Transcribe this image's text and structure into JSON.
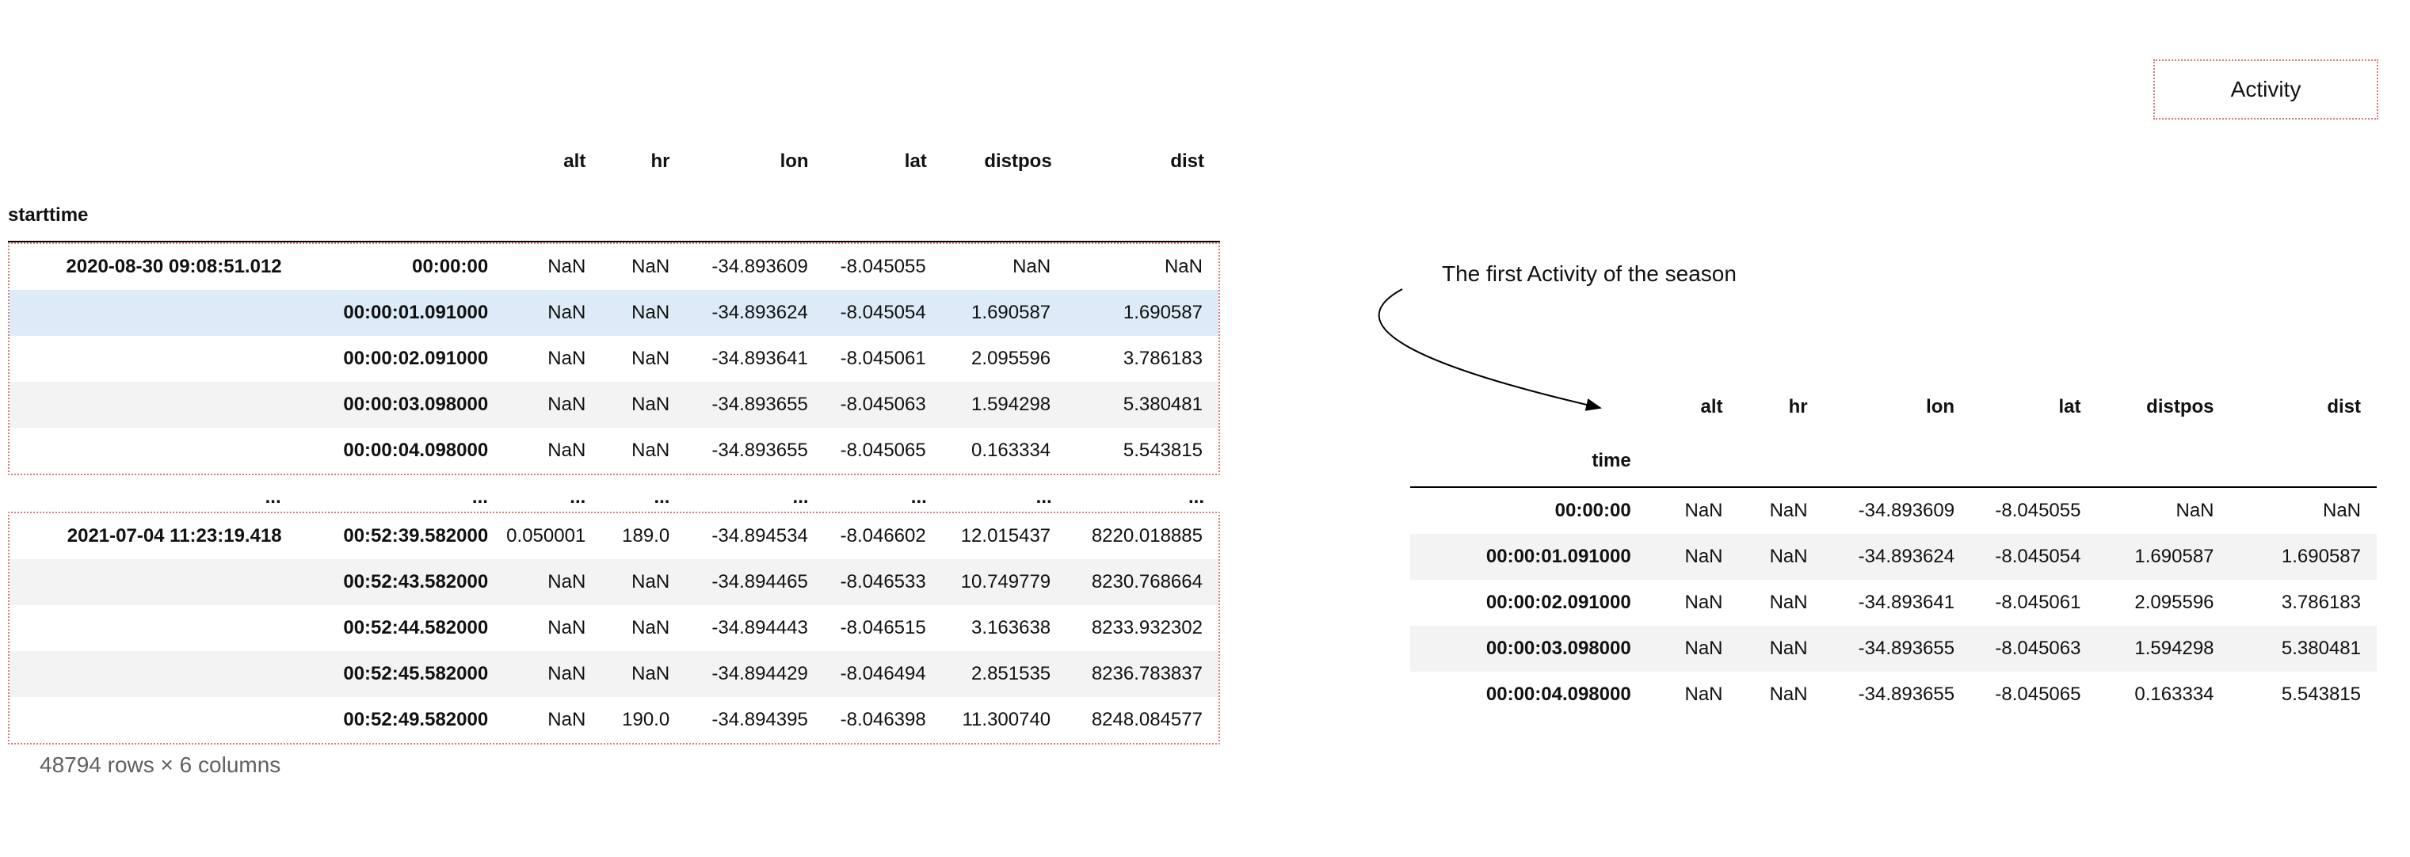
{
  "activity_label": "Activity",
  "annotation": "The first Activity of the season",
  "left_table": {
    "columns": [
      "alt",
      "hr",
      "lon",
      "lat",
      "distpos",
      "dist"
    ],
    "index_names": [
      "start",
      "time"
    ],
    "block1_start": "2020-08-30 09:08:51.012",
    "block1_rows": [
      {
        "time": "00:00:00",
        "alt": "NaN",
        "hr": "NaN",
        "lon": "-34.893609",
        "lat": "-8.045055",
        "distpos": "NaN",
        "dist": "NaN"
      },
      {
        "time": "00:00:01.091000",
        "alt": "NaN",
        "hr": "NaN",
        "lon": "-34.893624",
        "lat": "-8.045054",
        "distpos": "1.690587",
        "dist": "1.690587"
      },
      {
        "time": "00:00:02.091000",
        "alt": "NaN",
        "hr": "NaN",
        "lon": "-34.893641",
        "lat": "-8.045061",
        "distpos": "2.095596",
        "dist": "3.786183"
      },
      {
        "time": "00:00:03.098000",
        "alt": "NaN",
        "hr": "NaN",
        "lon": "-34.893655",
        "lat": "-8.045063",
        "distpos": "1.594298",
        "dist": "5.380481"
      },
      {
        "time": "00:00:04.098000",
        "alt": "NaN",
        "hr": "NaN",
        "lon": "-34.893655",
        "lat": "-8.045065",
        "distpos": "0.163334",
        "dist": "5.543815"
      }
    ],
    "ellipsis": "...",
    "block2_start": "2021-07-04 11:23:19.418",
    "block2_rows": [
      {
        "time": "00:52:39.582000",
        "alt": "0.050001",
        "hr": "189.0",
        "lon": "-34.894534",
        "lat": "-8.046602",
        "distpos": "12.015437",
        "dist": "8220.018885"
      },
      {
        "time": "00:52:43.582000",
        "alt": "NaN",
        "hr": "NaN",
        "lon": "-34.894465",
        "lat": "-8.046533",
        "distpos": "10.749779",
        "dist": "8230.768664"
      },
      {
        "time": "00:52:44.582000",
        "alt": "NaN",
        "hr": "NaN",
        "lon": "-34.894443",
        "lat": "-8.046515",
        "distpos": "3.163638",
        "dist": "8233.932302"
      },
      {
        "time": "00:52:45.582000",
        "alt": "NaN",
        "hr": "NaN",
        "lon": "-34.894429",
        "lat": "-8.046494",
        "distpos": "2.851535",
        "dist": "8236.783837"
      },
      {
        "time": "00:52:49.582000",
        "alt": "NaN",
        "hr": "190.0",
        "lon": "-34.894395",
        "lat": "-8.046398",
        "distpos": "11.300740",
        "dist": "8248.084577"
      }
    ],
    "footer": "48794 rows × 6 columns"
  },
  "right_table": {
    "columns": [
      "alt",
      "hr",
      "lon",
      "lat",
      "distpos",
      "dist"
    ],
    "index_name": "time",
    "rows": [
      {
        "time": "00:00:00",
        "alt": "NaN",
        "hr": "NaN",
        "lon": "-34.893609",
        "lat": "-8.045055",
        "distpos": "NaN",
        "dist": "NaN"
      },
      {
        "time": "00:00:01.091000",
        "alt": "NaN",
        "hr": "NaN",
        "lon": "-34.893624",
        "lat": "-8.045054",
        "distpos": "1.690587",
        "dist": "1.690587"
      },
      {
        "time": "00:00:02.091000",
        "alt": "NaN",
        "hr": "NaN",
        "lon": "-34.893641",
        "lat": "-8.045061",
        "distpos": "2.095596",
        "dist": "3.786183"
      },
      {
        "time": "00:00:03.098000",
        "alt": "NaN",
        "hr": "NaN",
        "lon": "-34.893655",
        "lat": "-8.045063",
        "distpos": "1.594298",
        "dist": "5.380481"
      },
      {
        "time": "00:00:04.098000",
        "alt": "NaN",
        "hr": "NaN",
        "lon": "-34.893655",
        "lat": "-8.045065",
        "distpos": "0.163334",
        "dist": "5.543815"
      }
    ]
  }
}
